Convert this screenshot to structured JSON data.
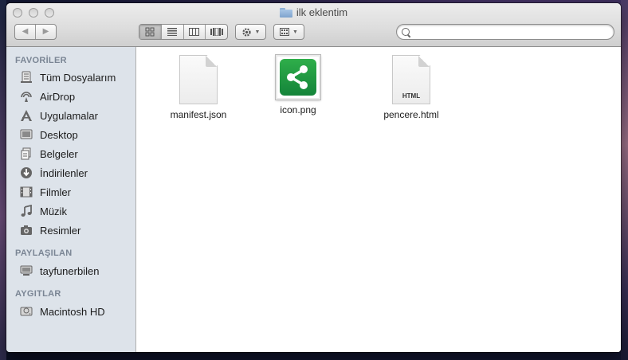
{
  "window": {
    "title": "ilk eklentim"
  },
  "toolbar": {
    "back_label": "◀",
    "forward_label": "▶",
    "views": [
      "icon-view",
      "list-view",
      "column-view",
      "coverflow-view"
    ],
    "search": {
      "value": "",
      "placeholder": ""
    }
  },
  "sidebar": {
    "sections": [
      {
        "title": "FAVORİLER",
        "items": [
          {
            "label": "Tüm Dosyalarım",
            "icon": "all-files-icon"
          },
          {
            "label": "AirDrop",
            "icon": "airdrop-icon"
          },
          {
            "label": "Uygulamalar",
            "icon": "applications-icon"
          },
          {
            "label": "Desktop",
            "icon": "desktop-icon"
          },
          {
            "label": "Belgeler",
            "icon": "documents-icon"
          },
          {
            "label": "İndirilenler",
            "icon": "downloads-icon"
          },
          {
            "label": "Filmler",
            "icon": "movies-icon"
          },
          {
            "label": "Müzik",
            "icon": "music-icon"
          },
          {
            "label": "Resimler",
            "icon": "pictures-icon"
          }
        ]
      },
      {
        "title": "PAYLAŞILAN",
        "items": [
          {
            "label": "tayfunerbilen",
            "icon": "shared-computer-icon"
          }
        ]
      },
      {
        "title": "AYGITLAR",
        "items": [
          {
            "label": "Macintosh HD",
            "icon": "hard-disk-icon"
          }
        ]
      }
    ]
  },
  "files": [
    {
      "name": "manifest.json",
      "type": "json",
      "icon": "json-file-icon"
    },
    {
      "name": "icon.png",
      "type": "png",
      "icon": "share-icon"
    },
    {
      "name": "pencere.html",
      "type": "html",
      "icon": "html-file-icon",
      "tag": "HTML"
    }
  ],
  "colors": {
    "sidebar_bg": "#dde3ea",
    "section_title": "#7a8594",
    "png_green": "#1f9a41"
  }
}
